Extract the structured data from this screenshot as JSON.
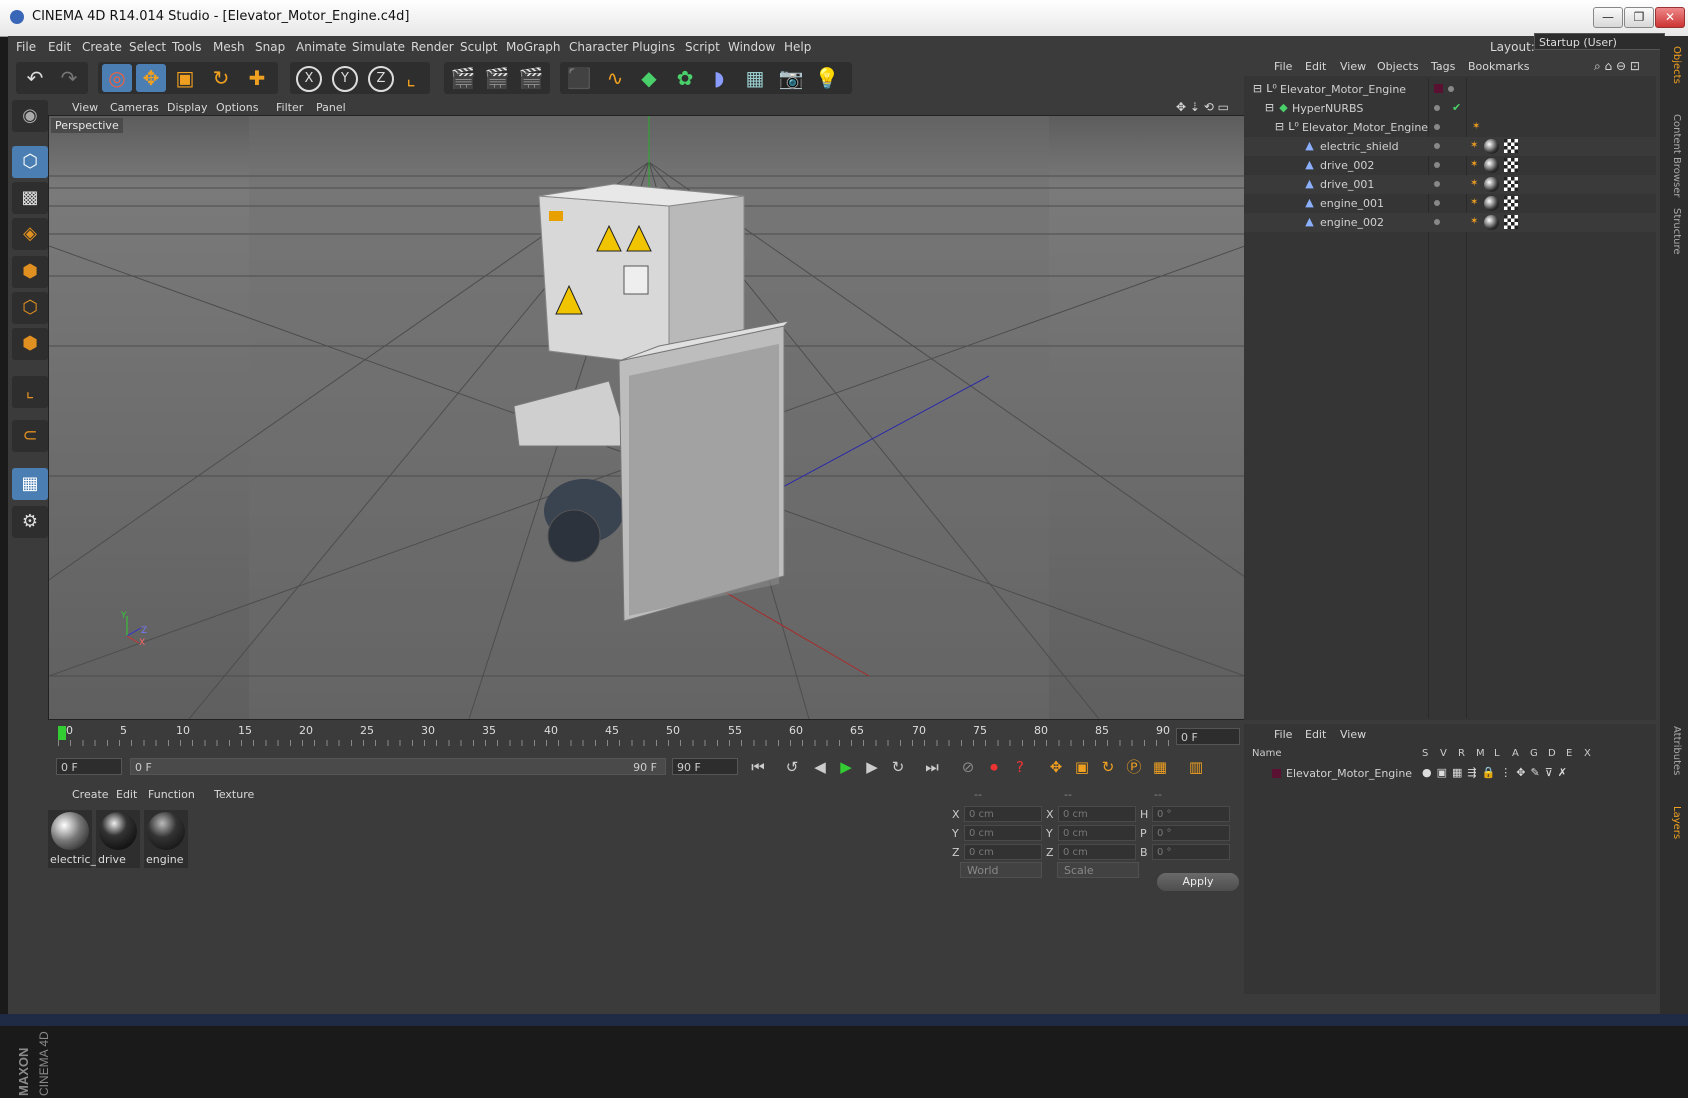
{
  "window": {
    "title": "CINEMA 4D R14.014 Studio - [Elevator_Motor_Engine.c4d]",
    "minimize": "—",
    "restore": "❐",
    "close": "✕"
  },
  "menubar": {
    "items": [
      "File",
      "Edit",
      "Create",
      "Select",
      "Tools",
      "Mesh",
      "Snap",
      "Animate",
      "Simulate",
      "Render",
      "Sculpt",
      "MoGraph",
      "Character",
      "Plugins",
      "Script",
      "Window",
      "Help"
    ],
    "layout_label": "Layout:",
    "layout_value": "Startup (User)"
  },
  "viewport": {
    "menu": [
      "View",
      "Cameras",
      "Display",
      "Options",
      "Filter",
      "Panel"
    ],
    "label": "Perspective",
    "axis_y": "Y",
    "axis_z": "Z",
    "axis_x": "X"
  },
  "object_manager": {
    "menu": [
      "File",
      "Edit",
      "View",
      "Objects",
      "Tags",
      "Bookmarks"
    ],
    "objects": [
      {
        "name": "Elevator_Motor_Engine",
        "depth": 0,
        "type": "null"
      },
      {
        "name": "HyperNURBS",
        "depth": 1,
        "type": "hypernurbs"
      },
      {
        "name": "Elevator_Motor_Engine",
        "depth": 2,
        "type": "null"
      },
      {
        "name": "electric_shield",
        "depth": 3,
        "type": "poly"
      },
      {
        "name": "drive_002",
        "depth": 3,
        "type": "poly"
      },
      {
        "name": "drive_001",
        "depth": 3,
        "type": "poly"
      },
      {
        "name": "engine_001",
        "depth": 3,
        "type": "poly"
      },
      {
        "name": "engine_002",
        "depth": 3,
        "type": "poly"
      }
    ]
  },
  "timeline": {
    "ticks": [
      "0",
      "5",
      "10",
      "15",
      "20",
      "25",
      "30",
      "35",
      "40",
      "45",
      "50",
      "55",
      "60",
      "65",
      "70",
      "75",
      "80",
      "85",
      "90"
    ],
    "current_frame": "0 F",
    "start_field": "0 F",
    "range_start": "0 F",
    "range_end": "90 F",
    "end_field": "90 F"
  },
  "material_manager": {
    "menu": [
      "Create",
      "Edit",
      "Function",
      "Texture"
    ],
    "materials": [
      "electric_",
      "drive",
      "engine"
    ]
  },
  "coordinates": {
    "header": [
      "--",
      "--",
      "--"
    ],
    "rows": [
      {
        "a": "X",
        "av": "0 cm",
        "b": "X",
        "bv": "0 cm",
        "c": "H",
        "cv": "0 °"
      },
      {
        "a": "Y",
        "av": "0 cm",
        "b": "Y",
        "bv": "0 cm",
        "c": "P",
        "cv": "0 °"
      },
      {
        "a": "Z",
        "av": "0 cm",
        "b": "Z",
        "bv": "0 cm",
        "c": "B",
        "cv": "0 °"
      }
    ],
    "mode_world": "World",
    "mode_scale": "Scale",
    "apply": "Apply"
  },
  "layer_manager": {
    "menu": [
      "File",
      "Edit",
      "View"
    ],
    "name_col": "Name",
    "flag_cols": [
      "S",
      "V",
      "R",
      "M",
      "L",
      "A",
      "G",
      "D",
      "E",
      "X"
    ],
    "layers": [
      "Elevator_Motor_Engine"
    ]
  },
  "side_tabs": [
    "Objects",
    "Content Browser",
    "Structure",
    "Attributes",
    "Layers"
  ],
  "brand": "MAXON CINEMA 4D",
  "colors": {
    "accent": "#f0a020",
    "selection": "#4b7fb4",
    "viewport_bg": "#6b6b6b"
  }
}
